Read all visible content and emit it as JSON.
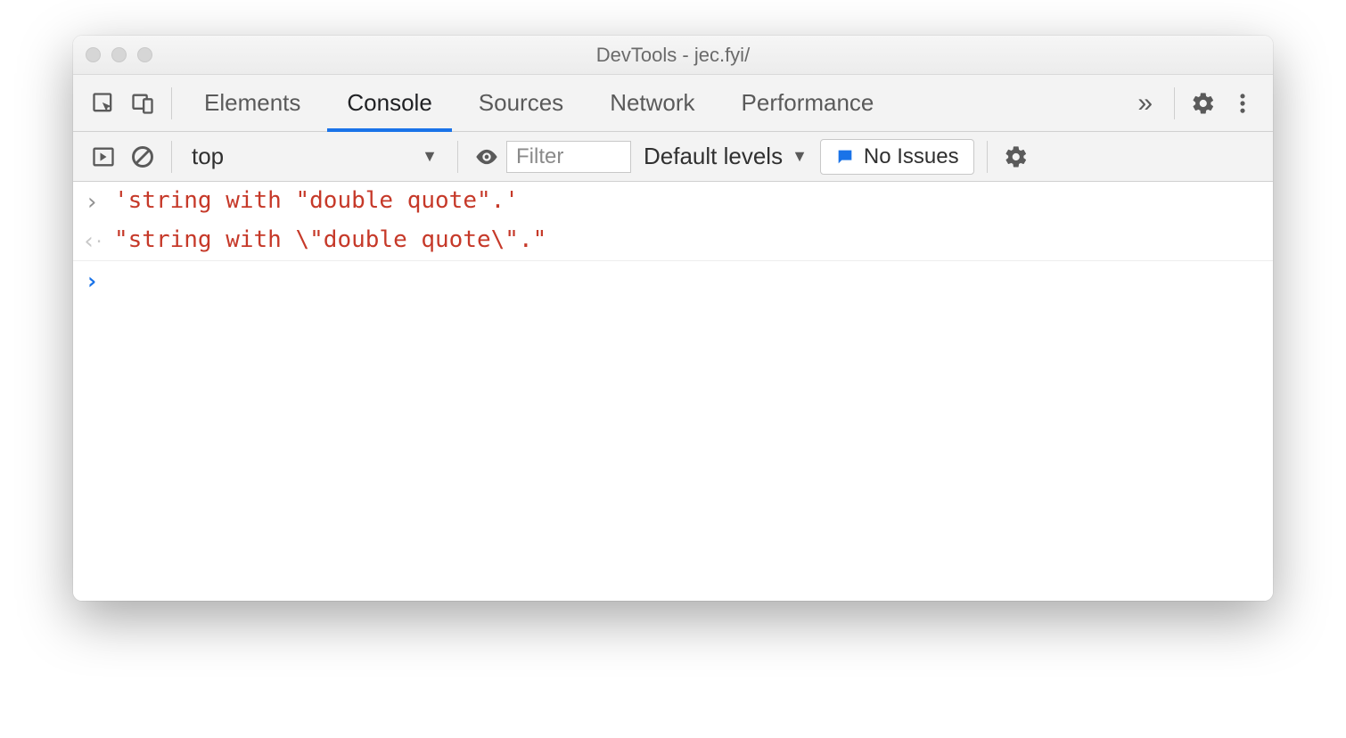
{
  "window": {
    "title": "DevTools - jec.fyi/"
  },
  "tabs": {
    "items": [
      "Elements",
      "Console",
      "Sources",
      "Network",
      "Performance"
    ],
    "active_index": 1
  },
  "toolbar": {
    "context": "top",
    "filter_placeholder": "Filter",
    "levels_label": "Default levels",
    "issues_label": "No Issues"
  },
  "console": {
    "lines": [
      {
        "kind": "in",
        "text": "'string with \"double quote\".'"
      },
      {
        "kind": "out",
        "text": "\"string with \\\"double quote\\\".\""
      }
    ]
  }
}
